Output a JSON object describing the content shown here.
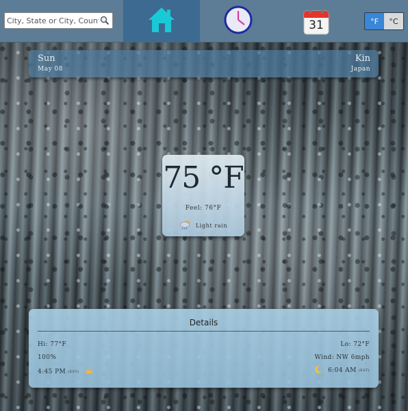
{
  "search": {
    "placeholder": "City, State or City, Country"
  },
  "nav": {
    "home_icon": "home-icon",
    "clock_icon": "clock-icon",
    "calendar_icon": "calendar-icon",
    "calendar_day": "31"
  },
  "units": {
    "f_label": "°F",
    "c_label": "°C",
    "selected": "°F"
  },
  "location": {
    "day": "Sun",
    "date": "May 08",
    "city": "Kin",
    "country": "Japan"
  },
  "current": {
    "temp": "75 °F",
    "feel": "Feel: 76°F",
    "condition": "Light rain",
    "condition_icon": "rain-cloud-icon"
  },
  "details": {
    "title": "Details",
    "hi": "Hi: 77°F",
    "lo": "Lo: 72°F",
    "humidity": "100%",
    "wind": "Wind: NW 6mph",
    "sunset_time": "4:45 PM",
    "sunset_tz": "(EST)",
    "sunrise_time": "6:04 AM",
    "sunrise_tz": "(EST)"
  },
  "colors": {
    "topbar": "#5d7c95",
    "active_tab": "#3d6a90",
    "toggle_on": "#3a86d8",
    "home_icon": "#19c9d6",
    "clock_ring": "#1c2aa0",
    "clock_hands": "#d63aa6",
    "calendar_header": "#e5342b"
  }
}
